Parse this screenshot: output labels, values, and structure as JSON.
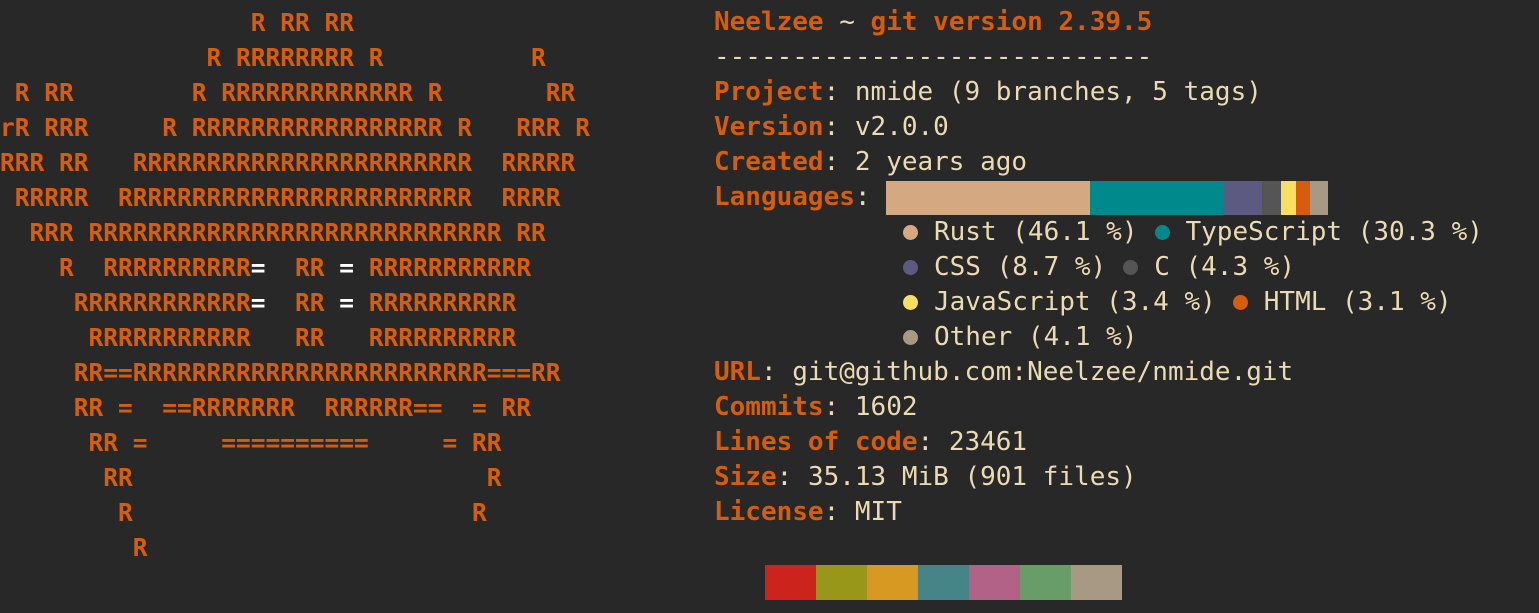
{
  "ascii_art": [
    {
      "main": "                 R RR RR"
    },
    {
      "main": "              R RRRRRRRR R          R"
    },
    {
      "main": " R RR        R RRRRRRRRRRRRR R       RR"
    },
    {
      "main": "rR RRR     R RRRRRRRRRRRRRRRRR R   RRR R"
    },
    {
      "main": "RRR RR   RRRRRRRRRRRRRRRRRRRRRRR  RRRRR"
    },
    {
      "main": " RRRRR  RRRRRRRRRRRRRRRRRRRRRRRR  RRRR"
    },
    {
      "main": "  RRR RRRRRRRRRRRRRRRRRRRRRRRRRRRR RR"
    },
    {
      "pre": "    R  RRRRRRRRRR",
      "eye1": "=",
      "mid": "  RR ",
      "eye2": "=",
      "post": " RRRRRRRRRRR"
    },
    {
      "pre": "     RRRRRRRRRRRR",
      "eye1": "=",
      "mid": "  RR ",
      "eye2": "=",
      "post": " RRRRRRRRRR"
    },
    {
      "main": "      RRRRRRRRRRR   RR   RRRRRRRRRR"
    },
    {
      "main": "     RR==RRRRRRRRRRRRRRRRRRRRRRRR===RR"
    },
    {
      "main": "     RR =  ==RRRRRRR  RRRRRR==  = RR"
    },
    {
      "main": "      RR =     ==========     = RR"
    },
    {
      "main": "       RR                        R"
    },
    {
      "main": "        R                       R"
    },
    {
      "main": "         R"
    }
  ],
  "header": {
    "user": "Neelzee",
    "separator": " ~ ",
    "host": "git version 2.39.5",
    "underline": "----------------------------"
  },
  "info": {
    "project_key": "Project",
    "project_value": "nmide (9 branches, 5 tags)",
    "version_key": "Version",
    "version_value": "v2.0.0",
    "created_key": "Created",
    "created_value": "2 years ago",
    "languages_key": "Languages",
    "url_key": "URL",
    "url_value": "git@github.com:Neelzee/nmide.git",
    "commits_key": "Commits",
    "commits_value": "1602",
    "loc_key": "Lines of code",
    "loc_value": "23461",
    "size_key": "Size",
    "size_value": "35.13 MiB (901 files)",
    "license_key": "License",
    "license_value": "MIT"
  },
  "languages": [
    {
      "label": "Rust (46.1 %)",
      "percent": 46.1,
      "color": "#d4a982"
    },
    {
      "label": "TypeScript (30.3 %)",
      "percent": 30.3,
      "color": "#00898c"
    },
    {
      "label": "CSS (8.7 %)",
      "percent": 8.7,
      "color": "#5d5a82"
    },
    {
      "label": "C (4.3 %)",
      "percent": 4.3,
      "color": "#555555"
    },
    {
      "label": "JavaScript (3.4 %)",
      "percent": 3.4,
      "color": "#f7df62"
    },
    {
      "label": "HTML (3.1 %)",
      "percent": 3.1,
      "color": "#d65d0e"
    },
    {
      "label": "Other (4.1 %)",
      "percent": 4.1,
      "color": "#a89984"
    }
  ],
  "palette": [
    "#cc241d",
    "#98971a",
    "#d79921",
    "#458588",
    "#b16286",
    "#689d6a",
    "#a89984"
  ]
}
